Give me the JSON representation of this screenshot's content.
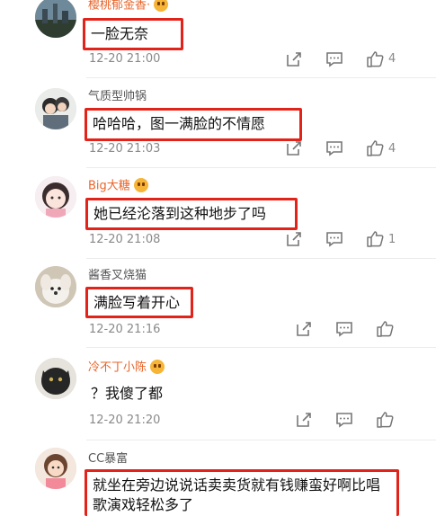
{
  "comments": [
    {
      "name": "樱桃郁金香·",
      "text": "一脸无奈",
      "time": "12-20 21:00",
      "likes": "4"
    },
    {
      "name": "气质型帅锅",
      "text": "哈哈哈，图一满脸的不情愿",
      "time": "12-20 21:03",
      "likes": "4"
    },
    {
      "name": "Big大糖",
      "text": "她已经沦落到这种地步了吗",
      "time": "12-20 21:08",
      "likes": "1"
    },
    {
      "name": "酱香叉烧猫",
      "text": "满脸写着开心",
      "time": "12-20 21:16",
      "likes": ""
    },
    {
      "name": "冷不丁小陈",
      "text": "？我傻了都",
      "time": "12-20 21:20",
      "likes": ""
    },
    {
      "name": "CC暴富",
      "text": "就坐在旁边说说话卖卖货就有钱赚蛮好啊比唱歌演戏轻松多了",
      "time": "",
      "likes": ""
    }
  ],
  "icons": {
    "share": "share-icon",
    "comment": "comment-icon",
    "like": "thumbs-up-icon",
    "vip": "vip-badge-icon"
  },
  "colors": {
    "highlight_border": "#e2231a",
    "vip_name": "#e8652b",
    "meta": "#8a8a8a"
  }
}
